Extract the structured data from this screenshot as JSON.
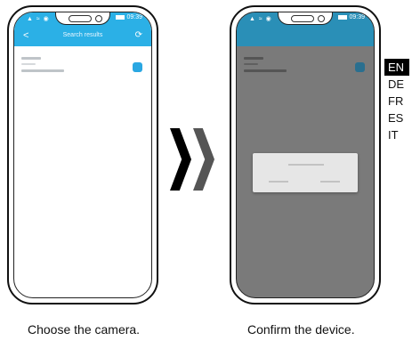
{
  "screen1": {
    "status_time": "09:39",
    "nav_title": "Search results",
    "caption": "Choose the camera."
  },
  "screen2": {
    "status_time": "09:39",
    "caption": "Confirm the device."
  },
  "languages": [
    "EN",
    "DE",
    "FR",
    "ES",
    "IT"
  ],
  "active_language": "EN",
  "colors": {
    "accent": "#2bb0e6",
    "dark_overlay": "#7a7a7a"
  }
}
